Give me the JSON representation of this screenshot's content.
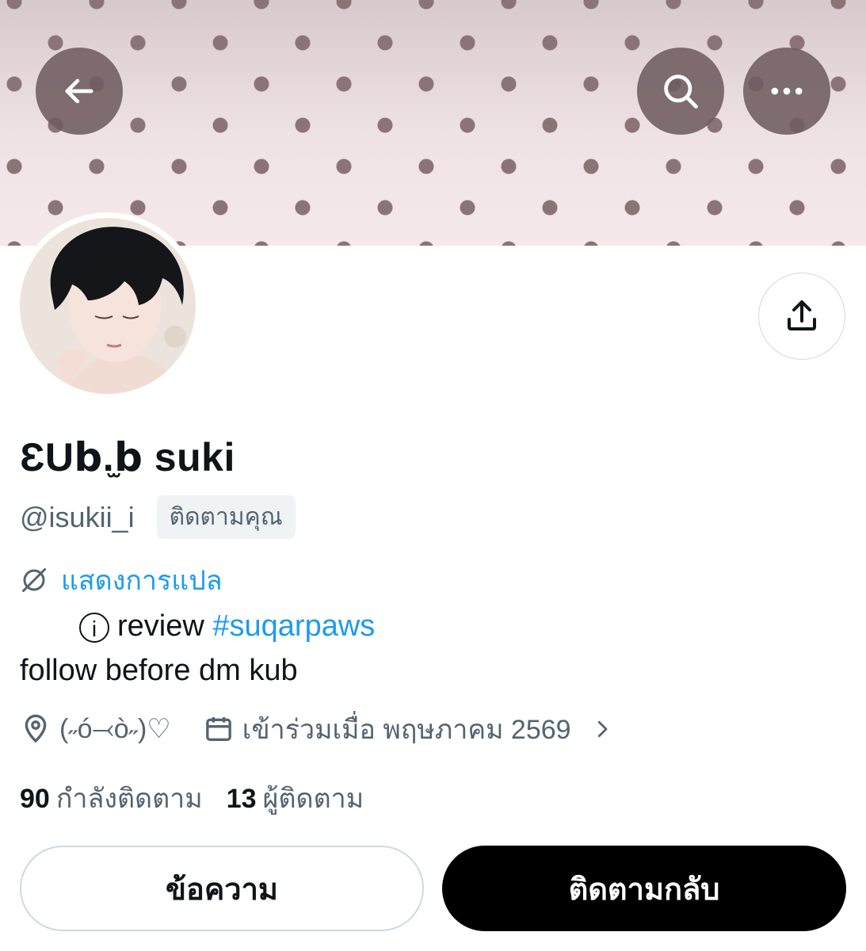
{
  "header": {
    "back_icon": "arrow-left-icon",
    "search_icon": "search-icon",
    "more_icon": "more-horizontal-icon",
    "banner_colors": {
      "background": "#ecdde0",
      "dots": "#8a7478"
    }
  },
  "profile": {
    "display_name": "ƐU𝗯.̫𝗯 suki",
    "handle": "@isukii_i",
    "follows_you_badge": "ติดตามคุณ",
    "translate_link": "แสดงการแปล",
    "bio_line1_icon_char": "i",
    "bio_line1_text": "review",
    "bio_hashtag": "#suqarpaws",
    "bio_line2": "follow before dm kub",
    "location": "(˶ó⤙ò˶)♡",
    "joined": "เข้าร่วมเมื่อ พฤษภาคม 2569",
    "following_count": "90",
    "following_label": "กำลังติดตาม",
    "followers_count": "13",
    "followers_label": "ผู้ติดตาม"
  },
  "actions": {
    "message_label": "ข้อความ",
    "follow_back_label": "ติดตามกลับ"
  },
  "colors": {
    "accent": "#1d9bf0",
    "secondary_text": "#536471",
    "primary_text": "#0f1419"
  }
}
